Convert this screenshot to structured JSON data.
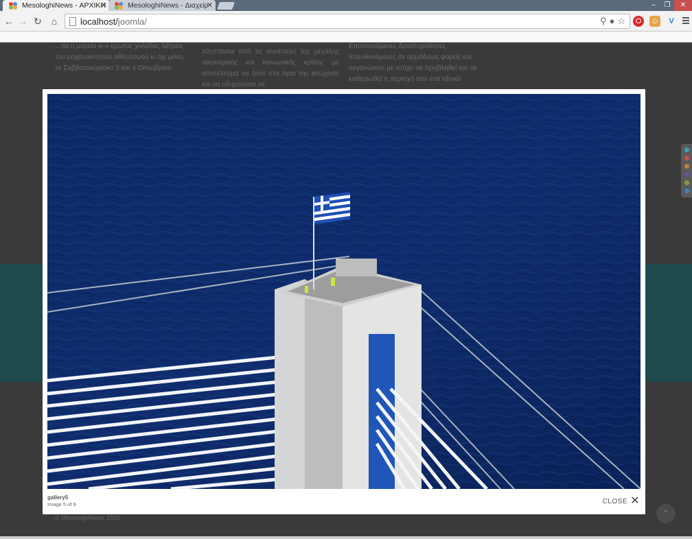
{
  "browser": {
    "tabs": [
      {
        "title": "MesologhiNews - ΑΡΧΙΚΗ",
        "active": true
      },
      {
        "title": "MesologhiNews - Διαχείρ",
        "active": false
      }
    ],
    "url_host": "localhost/",
    "url_path": "joomla/",
    "accent_close": "#c75050"
  },
  "page_bg": {
    "col1": "...ται η μαγεία κι ο ερωτος χυλάδες λάτρεις του μηχανοκίνητου αθλητισμού κι όχι μόνο, το Σαββατοκύριακο 3 και 4 Οκτωβρίου",
    "col2": "πληττονται από τις συνέπειες της μεγάλης οικονομικής και κοινωνικής κρίσης με αποτέλεσμα να ζουν στα όρια της φτώχειας και να οδηγούνται σε",
    "col3": "Εποπτευόμενες δραστηριότητες απευθυνόμενες σε αρμόδιους φορείς και οργανώσεις με στόχο να προβληθεί και να καθιερωθεί η περιοχή σαν ένα εθνικό",
    "footer": "© MesologhiNews 2015"
  },
  "lightbox": {
    "title": "gallery5",
    "counter": "Image 5 of 9",
    "close_label": "CLOSE"
  },
  "icons": {
    "back": "back-arrow-icon",
    "forward": "forward-arrow-icon",
    "reload": "reload-icon",
    "home": "home-icon",
    "close": "close-icon"
  }
}
